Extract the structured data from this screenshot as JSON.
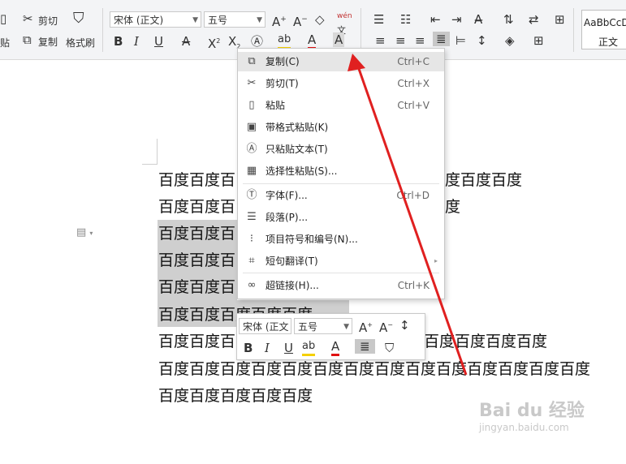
{
  "ribbon": {
    "cut_label": "剪切",
    "copy_label": "复制",
    "paste_label": "贴",
    "format_painter_label": "格式刷",
    "font_name": "宋体 (正文)",
    "font_size": "五号",
    "phonetic_glyph": "wén",
    "style_preview_text": "AaBbCcD",
    "style_name": "正文"
  },
  "context_menu": {
    "items": [
      {
        "icon": "copy-icon",
        "label": "复制(C)",
        "shortcut": "Ctrl+C"
      },
      {
        "icon": "cut-icon",
        "label": "剪切(T)",
        "shortcut": "Ctrl+X"
      },
      {
        "icon": "paste-icon",
        "label": "粘贴",
        "shortcut": "Ctrl+V"
      },
      {
        "icon": "paste-format-icon",
        "label": "带格式粘贴(K)",
        "shortcut": ""
      },
      {
        "icon": "paste-text-icon",
        "label": "只粘贴文本(T)",
        "shortcut": ""
      },
      {
        "icon": "paste-special-icon",
        "label": "选择性粘贴(S)...",
        "shortcut": ""
      },
      {
        "icon": "font-icon",
        "label": "字体(F)...",
        "shortcut": "Ctrl+D"
      },
      {
        "icon": "paragraph-icon",
        "label": "段落(P)...",
        "shortcut": ""
      },
      {
        "icon": "bullets-icon",
        "label": "项目符号和编号(N)...",
        "shortcut": ""
      },
      {
        "icon": "translate-icon",
        "label": "短句翻译(T)",
        "shortcut": ""
      },
      {
        "icon": "hyperlink-icon",
        "label": "超链接(H)...",
        "shortcut": "Ctrl+K"
      }
    ]
  },
  "mini_toolbar": {
    "font_name": "宋体 (正文",
    "font_size": "五号"
  },
  "document": {
    "lines": [
      "百度百度百",
      "百度百度百",
      "百度百度百",
      "百度百度百",
      "百度百度百",
      "百度百度百度百度百度",
      "百度百度百",
      "百度百度百度百度百度百度百度百度百度百度百度百度百度百度",
      "百度百度百度百度百度"
    ],
    "line1_tail": "度百度百度",
    "line2_tail": "度",
    "line7_tail": "百度百度百度百度"
  },
  "watermark": {
    "brand": "Bai du 经验",
    "url": "jingyan.baidu.com"
  },
  "colors": {
    "arrow": "#e02020",
    "selection": "#cfcfcf",
    "highlighter": "#f5d000",
    "font_color_bar": "#e01010"
  }
}
